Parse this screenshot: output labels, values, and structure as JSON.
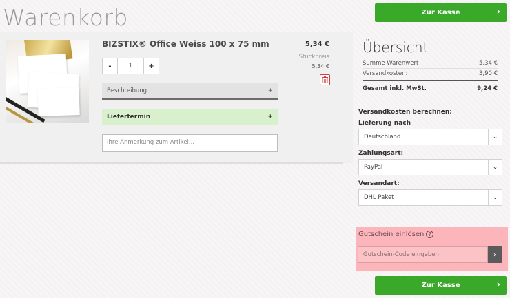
{
  "page": {
    "title": "Warenkorb"
  },
  "checkout": {
    "label": "Zur Kasse",
    "chevron": "›"
  },
  "item": {
    "name": "BIZSTIX® Office Weiss 100 x 75 mm",
    "price": "5,34 €",
    "unit_label": "Stückpreis",
    "unit_price": "5,34 €",
    "quantity": "1",
    "minus": "-",
    "plus": "+",
    "description_label": "Beschreibung",
    "description_toggle": "+",
    "delivery_label": "Liefertermin",
    "delivery_toggle": "+",
    "note_placeholder": "Ihre Anmerkung zum Artikel..."
  },
  "summary": {
    "title": "Übersicht",
    "goods_label": "Summe Warenwert",
    "goods_value": "5,34 €",
    "shipping_label": "Versandkosten:",
    "shipping_value": "3,90 €",
    "total_label": "Gesamt inkl. MwSt.",
    "total_value": "9,24 €"
  },
  "shipping_calc": {
    "heading": "Versandkosten berechnen:",
    "country_label": "Lieferung nach",
    "country_value": "Deutschland",
    "payment_label": "Zahlungsart:",
    "payment_value": "PayPal",
    "method_label": "Versandart:",
    "method_value": "DHL Paket",
    "arrow": "⌄"
  },
  "voucher": {
    "title": "Gutschein einlösen",
    "help": "?",
    "placeholder": "Gutschein-Code eingeben",
    "button": "›"
  },
  "colors": {
    "primary": "#3aa829",
    "voucher_bg": "#fcb6bb",
    "delivery_bg": "#d9f0cd",
    "delete": "#d04040"
  }
}
